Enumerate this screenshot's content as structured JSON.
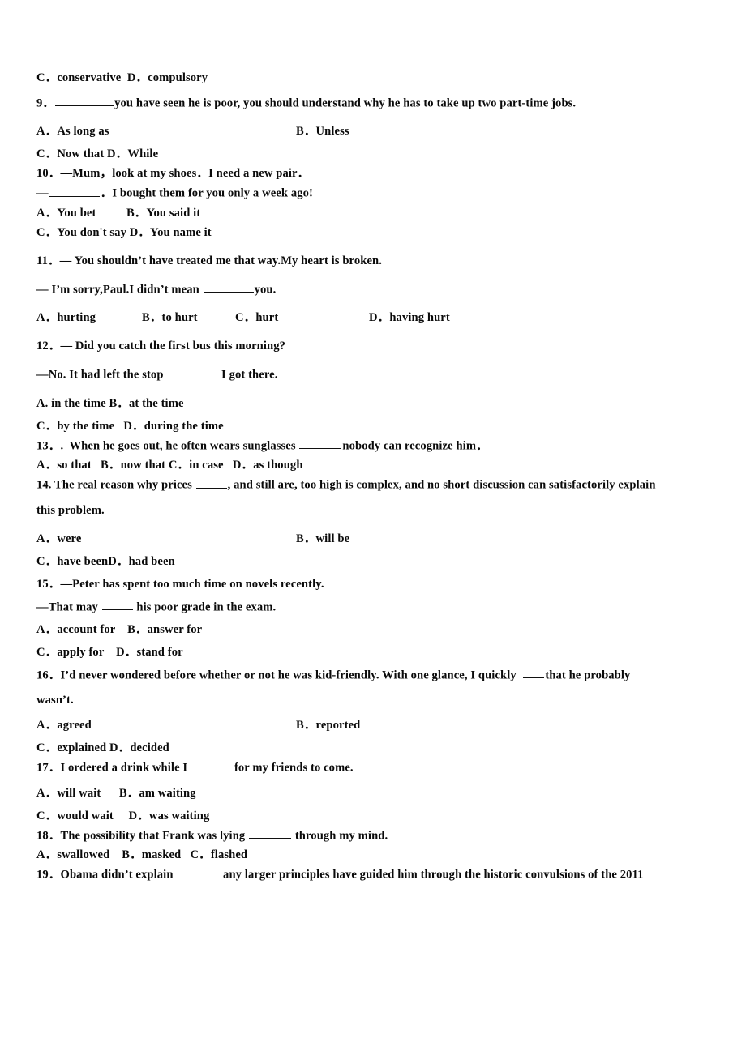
{
  "document": {
    "kind": "english-grammar-multiple-choice-worksheet",
    "page_background": "#ffffff",
    "text_color": "#0a0a0a"
  },
  "lines": {
    "q8_options_cd": "C．conservative  D．compulsory",
    "q9_stem_pre": "9．",
    "q9_stem_post": "you have seen he is poor, you should understand why he has to take up two part-time jobs.",
    "q9_opt_a": "A．As long as",
    "q9_opt_b": "B．Unless",
    "q9_opt_cd": "C．Now that D．While",
    "q10_stem": "10．—Mum，look at my shoes．I need a new pair．",
    "q10_reply_pre": "—",
    "q10_reply_post": "．I bought them for you only a week ago!",
    "q10_opt_ab": "A．You bet          B．You said it",
    "q10_opt_cd": "C．You don't say D．You name it",
    "q11_stem": "11．— You shouldn’t have treated me that way.My heart is broken.",
    "q11_reply_pre": "— I’m sorry,Paul.I didn’t mean",
    "q11_reply_post": "you.",
    "q11_opt_a": "A．hurting",
    "q11_opt_b": "B．to hurt",
    "q11_opt_c": "C．hurt",
    "q11_opt_d": "D．having hurt",
    "q12_stem": "12．— Did you catch the first bus this morning?",
    "q12_reply_pre": "—No. It had left the stop",
    "q12_reply_post": "I got there.",
    "q12_opt_ab": "A. in the time B．at the time",
    "q12_opt_cd": "C．by the time   D．during the time",
    "q13_stem_pre": "13．.  When he goes out, he often wears sunglasses",
    "q13_stem_post": "nobody can recognize him．",
    "q13_opts": "A．so that   B．now that C．in case   D．as though",
    "q14_stem_pre": "14. The real reason why prices",
    "q14_stem_post": ", and still are, too high is complex, and no short discussion can satisfactorily explain",
    "q14_stem_cont": "this problem.",
    "q14_opt_a": "A．were",
    "q14_opt_b": "B．will be",
    "q14_opt_cd": "C．have beenD．had been",
    "q15_stem": "15．—Peter has spent too much time on novels recently.",
    "q15_reply_pre": "—That may",
    "q15_reply_post": "his poor grade in the exam.",
    "q15_opt_ab": "A．account for    B．answer for",
    "q15_opt_cd": "C．apply for    D．stand for",
    "q16_stem_pre": "16．I’d never wondered before whether or not he was kid-friendly. With one glance, I quickly",
    "q16_stem_post": "that he probably",
    "q16_stem_cont": "wasn’t.",
    "q16_opt_a": "A．agreed",
    "q16_opt_b": "B．reported",
    "q16_opt_cd": "C．explained D．decided",
    "q17_stem_pre": "17．I ordered a drink while I",
    "q17_stem_post": "for my friends to come.",
    "q17_opt_ab": "A．will wait      B．am waiting",
    "q17_opt_cd": "C．would wait     D．was waiting",
    "q18_stem_pre": "18．The possibility that Frank was lying",
    "q18_stem_post": "through my mind.",
    "q18_opts": "A．swallowed    B．masked   C．flashed",
    "q19_stem_pre": "19．Obama didn’t explain",
    "q19_stem_post": "any larger principles have guided him through the historic convulsions of the 2011"
  }
}
